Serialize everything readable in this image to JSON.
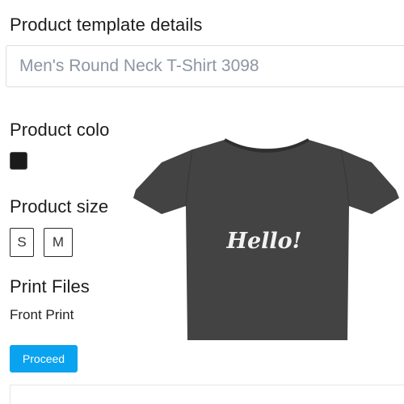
{
  "template": {
    "heading": "Product template details",
    "product_name": "Men's Round Neck T-Shirt 3098"
  },
  "color": {
    "heading": "Product colo",
    "options": [
      {
        "value": "#1b1b1b"
      }
    ]
  },
  "size": {
    "heading": "Product size",
    "options": [
      "S",
      "M"
    ]
  },
  "print_files": {
    "heading": "Print Files",
    "front_label": "Front Print"
  },
  "actions": {
    "proceed_label": "Proceed"
  },
  "mockup": {
    "shirt_color": "#434343",
    "print_text": "Hello!"
  }
}
